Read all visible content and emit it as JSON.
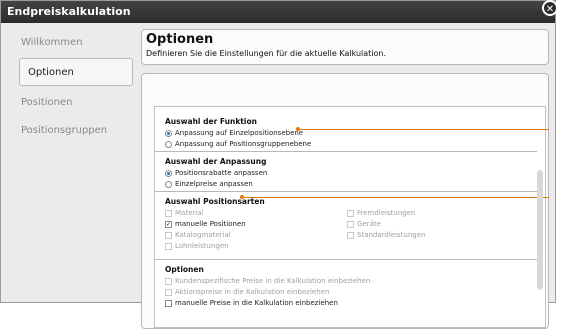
{
  "window": {
    "title": "Endpreiskalkulation",
    "close_symbol": "✕"
  },
  "sidebar": {
    "items": [
      {
        "label": "Willkommen",
        "active": false
      },
      {
        "label": "Optionen",
        "active": true
      },
      {
        "label": "Positionen",
        "active": false
      },
      {
        "label": "Positionsgruppen",
        "active": false
      }
    ]
  },
  "header": {
    "title": "Optionen",
    "subtitle": "Definieren Sie die Einstellungen für die aktuelle Kalkulation."
  },
  "sections": {
    "funktion": {
      "title": "Auswahl der Funktion",
      "options": [
        {
          "label": "Anpassung auf Einzelpositionsebene",
          "checked": true
        },
        {
          "label": "Anpassung auf Positionsgruppenebene",
          "checked": false
        }
      ]
    },
    "anpassung": {
      "title": "Auswahl der Anpassung",
      "options": [
        {
          "label": "Positionsrabatte anpassen",
          "checked": true
        },
        {
          "label": "Einzelpreise anpassen",
          "checked": false
        }
      ]
    },
    "positionsarten": {
      "title": "Auswahl Positionsarten",
      "left": [
        {
          "label": "Material",
          "checked": false,
          "disabled": true
        },
        {
          "label": "manuelle Positionen",
          "checked": true,
          "disabled": false
        },
        {
          "label": "Katalogmaterial",
          "checked": false,
          "disabled": true
        },
        {
          "label": "Lohnleistungen",
          "checked": false,
          "disabled": true
        }
      ],
      "right": [
        {
          "label": "Fremdleistungen",
          "checked": false,
          "disabled": true
        },
        {
          "label": "Geräte",
          "checked": false,
          "disabled": true
        },
        {
          "label": "Standardleistungen",
          "checked": false,
          "disabled": true
        }
      ]
    },
    "optionen": {
      "title": "Optionen",
      "options": [
        {
          "label": "Kundenspezifische Preise in die Kalkulation einbeziehen",
          "checked": false,
          "disabled": true
        },
        {
          "label": "Aktionspreise in die Kalkulation einbeziehen",
          "checked": false,
          "disabled": true
        },
        {
          "label": "manuelle Preise in die Kalkulation einbeziehen",
          "checked": false,
          "disabled": false
        }
      ]
    }
  },
  "colors": {
    "accent": "#e07b00",
    "titlebar": "#2b2b2b",
    "radio_selected": "#2e6fbf"
  }
}
